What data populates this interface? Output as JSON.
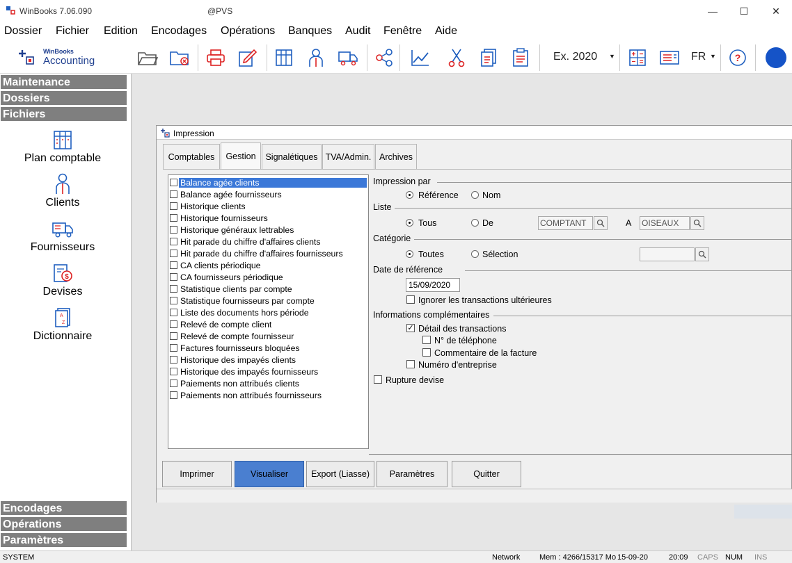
{
  "window": {
    "title": "WinBooks 7.06.090",
    "subtitle": "@PVS"
  },
  "menu": [
    "Dossier",
    "Fichier",
    "Edition",
    "Encodages",
    "Opérations",
    "Banques",
    "Audit",
    "Fenêtre",
    "Aide"
  ],
  "logo": {
    "brand": "WinBooks",
    "product": "Accounting"
  },
  "toolbar": {
    "exercise": "Ex. 2020",
    "language": "FR"
  },
  "sidebar": {
    "sections_top": [
      "Maintenance",
      "Dossiers",
      "Fichiers"
    ],
    "items": [
      {
        "label": "Plan comptable",
        "icon": "chart-of-accounts-icon"
      },
      {
        "label": "Clients",
        "icon": "client-person-icon"
      },
      {
        "label": "Fournisseurs",
        "icon": "supplier-truck-icon"
      },
      {
        "label": "Devises",
        "icon": "currency-icon"
      },
      {
        "label": "Dictionnaire",
        "icon": "dictionary-icon"
      }
    ],
    "sections_bottom": [
      "Encodages",
      "Opérations",
      "Paramètres"
    ]
  },
  "dialog": {
    "title": "Impression",
    "tabs": [
      "Comptables",
      "Gestion",
      "Signalétiques",
      "TVA/Admin.",
      "Archives"
    ],
    "active_tab": "Gestion",
    "reports": [
      "Balance agée clients",
      "Balance agée fournisseurs",
      "Historique clients",
      "Historique fournisseurs",
      "Historique généraux lettrables",
      "Hit parade du chiffre d'affaires clients",
      "Hit parade du chiffre d'affaires fournisseurs",
      "CA clients périodique",
      "CA fournisseurs périodique",
      "Statistique clients par compte",
      "Statistique fournisseurs par compte",
      "Liste des documents hors période",
      "Relevé de compte client",
      "Relevé de compte fournisseur",
      "Factures fournisseurs bloquées",
      "Historique des impayés clients",
      "Historique des impayés fournisseurs",
      "Paiements non attribués clients",
      "Paiements non attribués fournisseurs"
    ],
    "selected_report": "Balance agée clients",
    "impression_par": {
      "label": "Impression par",
      "opt1": "Référence",
      "opt2": "Nom",
      "selected": "Référence"
    },
    "liste": {
      "label": "Liste",
      "opt1": "Tous",
      "opt2": "De",
      "selected": "Tous",
      "from": "COMPTANT",
      "to_label": "A",
      "to": "OISEAUX"
    },
    "categorie": {
      "label": "Catégorie",
      "opt1": "Toutes",
      "opt2": "Sélection",
      "selected": "Toutes",
      "value": ""
    },
    "date_ref": {
      "label": "Date de référence",
      "value": "15/09/2020",
      "ignore_label": "Ignorer les transactions ultérieures",
      "ignore_checked": false
    },
    "infos": {
      "label": "Informations complémentaires",
      "detail": "Détail des transactions",
      "detail_checked": true,
      "phone": "N° de téléphone",
      "phone_checked": false,
      "comment": "Commentaire de la facture",
      "comment_checked": false,
      "company_no": "Numéro d'entreprise",
      "company_no_checked": false
    },
    "rupture": {
      "label": "Rupture devise",
      "checked": false
    },
    "buttons": {
      "print": "Imprimer",
      "view": "Visualiser",
      "export": "Export (Liasse)",
      "params": "Paramètres",
      "quit": "Quitter"
    }
  },
  "statusbar": {
    "user": "SYSTEM",
    "network": "Network",
    "mem": "Mem : 4266/15317 Mo",
    "date": "15-09-20",
    "time": "20:09",
    "caps": "CAPS",
    "num": "NUM",
    "ins": "INS"
  },
  "colors": {
    "accent": "#3b78d8",
    "sidebar_header": "#7f7f7f",
    "icon_blue": "#1f5fbf",
    "avatar": "#1553c7"
  }
}
